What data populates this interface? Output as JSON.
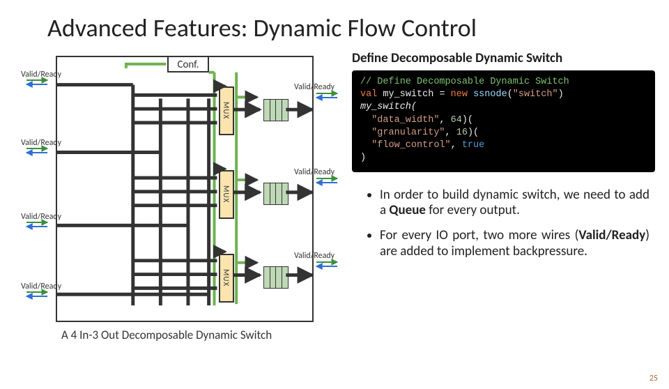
{
  "title": "Advanced Features: Dynamic Flow Control",
  "page_number": "25",
  "diagram": {
    "conf_label": "Conf.",
    "mux_label": "MUX",
    "input_label": "Valid/Ready",
    "output_label": "Valid/Ready",
    "caption": "A 4 In-3 Out Decomposable Dynamic Switch"
  },
  "section_heading": "Define Decomposable Dynamic Switch",
  "code": {
    "comment": "// Define Decomposable Dynamic Switch",
    "l2_kw": "val",
    "l2_var": "my_switch",
    "l2_new": "new",
    "l2_type": "ssnode",
    "l2_arg": "\"switch\"",
    "l3": "my_switch(",
    "l4_key": "\"data_width\"",
    "l4_val": "64",
    "l5_key": "\"granularity\"",
    "l5_val": "16",
    "l6_key": "\"flow_control\"",
    "l6_val": "true",
    "l7": ")"
  },
  "bullets": {
    "b1_pre": "In order to build dynamic switch, we need to add a ",
    "b1_bold": "Queue",
    "b1_post": " for every output.",
    "b2_pre": "For every IO port, two more wires (",
    "b2_bold": "Valid/Ready",
    "b2_post": ") are added to implement backpressure."
  }
}
